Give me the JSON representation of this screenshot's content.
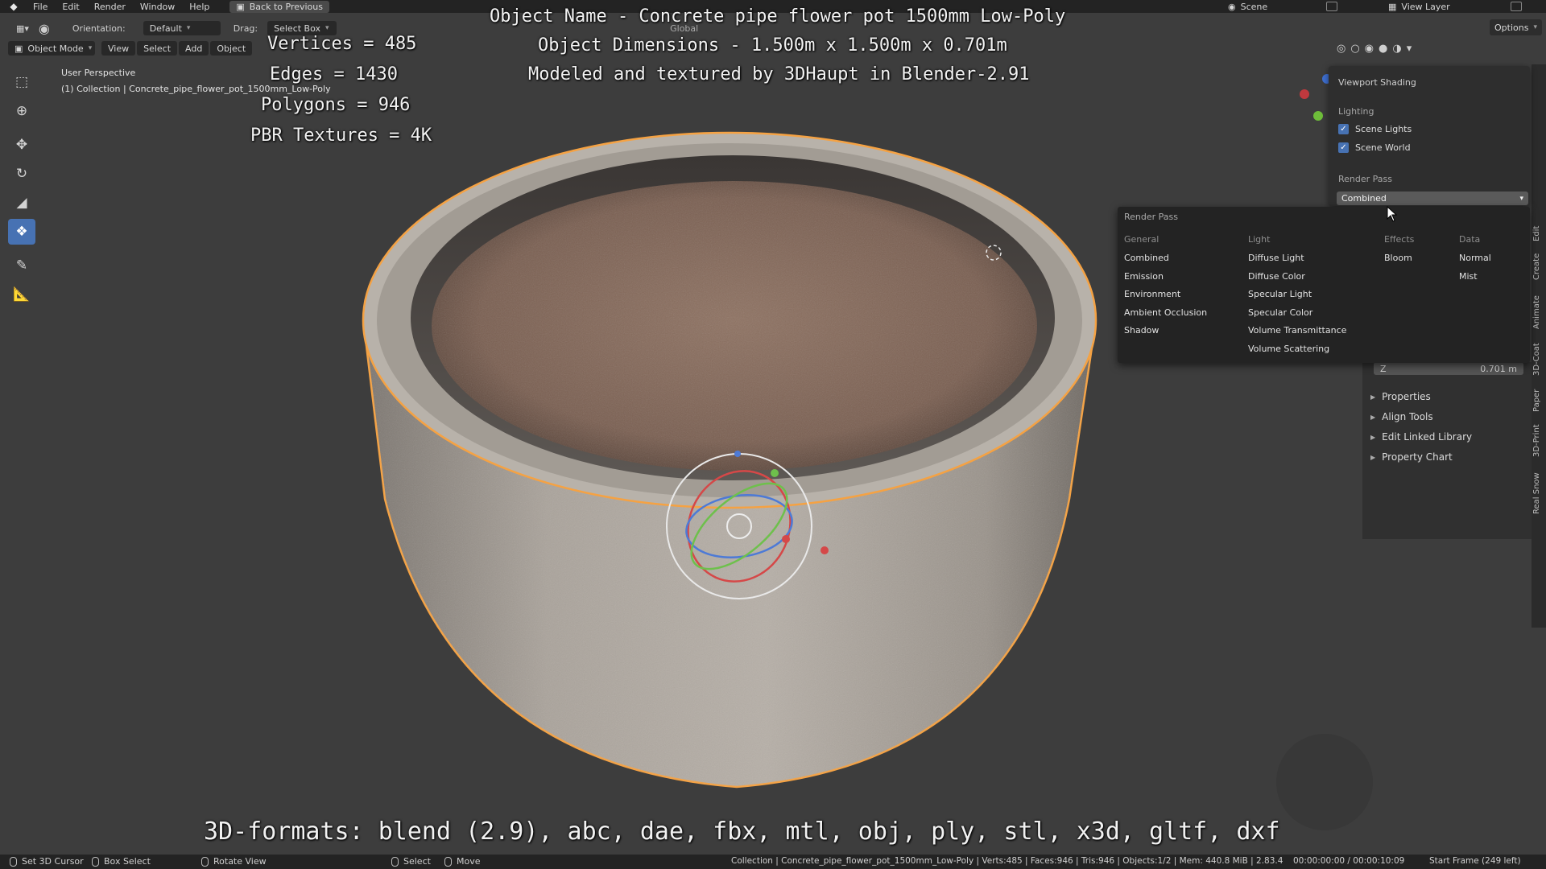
{
  "topbar": {
    "menu": [
      "File",
      "Edit",
      "Render",
      "Window",
      "Help"
    ],
    "back_button": "Back to Previous",
    "scene": "Scene",
    "view_layer": "View Layer"
  },
  "header": {
    "orientation_label": "Orientation:",
    "orientation_value": "Default",
    "drag_label": "Drag:",
    "drag_value": "Select Box",
    "transform_value": "Global",
    "options_label": "Options",
    "mode": "Object Mode",
    "menus": [
      "View",
      "Select",
      "Add",
      "Object"
    ]
  },
  "viewport": {
    "perspective": "User Perspective",
    "collection_line": "(1) Collection | Concrete_pipe_flower_pot_1500mm_Low-Poly"
  },
  "overlay": {
    "vertices": "Vertices = 485",
    "edges": "Edges = 1430",
    "polygons": "Polygons = 946",
    "textures": "PBR Textures = 4K",
    "object_name": "Object Name - Concrete pipe flower pot 1500mm Low-Poly",
    "dimensions": "Object Dimensions -  1.500m x 1.500m x 0.701m",
    "credit": "Modeled and textured by 3DHaupt in Blender-2.91",
    "formats": "3D-formats: blend (2.9), abc, dae, fbx, mtl, obj, ply, stl, x3d, gltf, dxf"
  },
  "shading_popover": {
    "title": "Viewport Shading",
    "lighting_label": "Lighting",
    "scene_lights": "Scene Lights",
    "scene_world": "Scene World",
    "render_pass_label": "Render Pass",
    "render_pass_value": "Combined"
  },
  "render_pass_menu": {
    "title": "Render Pass",
    "general": {
      "head": "General",
      "items": [
        "Combined",
        "Emission",
        "Environment",
        "Ambient Occlusion",
        "Shadow"
      ]
    },
    "light": {
      "head": "Light",
      "items": [
        "Diffuse Light",
        "Diffuse Color",
        "Specular Light",
        "Specular Color",
        "Volume Transmittance",
        "Volume Scattering"
      ]
    },
    "effects": {
      "head": "Effects",
      "items": [
        "Bloom"
      ]
    },
    "data": {
      "head": "Data",
      "items": [
        "Normal",
        "Mist"
      ]
    }
  },
  "npanel": {
    "z_label": "Z",
    "z_value": "0.701 m",
    "sections": [
      "Properties",
      "Align Tools",
      "Edit Linked Library",
      "Property Chart"
    ]
  },
  "sidetabs": [
    "Edit",
    "Create",
    "Animate",
    "3D-Coat",
    "Paper",
    "3D-Print",
    "Real Snow"
  ],
  "statusbar": {
    "set_cursor": "Set 3D Cursor",
    "box_select": "Box Select",
    "rotate_view": "Rotate View",
    "select": "Select",
    "move": "Move",
    "stats": "Collection | Concrete_pipe_flower_pot_1500mm_Low-Poly | Verts:485 | Faces:946 | Tris:946 | Objects:1/2 | Mem: 440.8 MiB | 2.83.4",
    "time": "00:00:00:00 / 00:00:10:09",
    "start_frame": "Start Frame (249 left)"
  },
  "colors": {
    "active_blue": "#4772b3",
    "selection_outline": "#f5a243",
    "background": "#3d3d3d"
  },
  "icons": [
    "blender-logo-icon",
    "select-box-icon",
    "cursor-icon",
    "move-icon",
    "rotate-icon",
    "scale-icon",
    "transform-icon",
    "annotate-icon",
    "measure-icon",
    "checkbox-icon",
    "chevron-down-icon",
    "triangle-right-icon",
    "mouse-icon"
  ]
}
